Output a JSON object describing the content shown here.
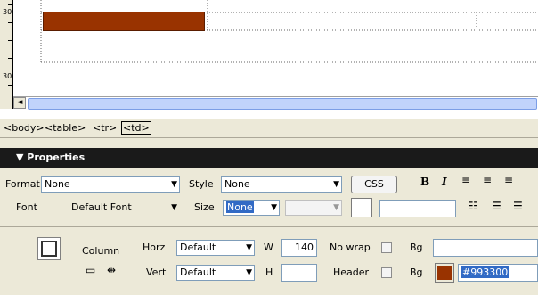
{
  "ruler": {
    "top_label": "30",
    "bottom_label": "30"
  },
  "scroll_left_arrow": "◄",
  "tag_selector": {
    "tags": [
      "<body>",
      "<table>",
      "<tr>"
    ],
    "selected": "<td>"
  },
  "properties": {
    "title": "▼ Properties",
    "format_label": "Format",
    "format_value": "None",
    "style_label": "Style",
    "style_value": "None",
    "css_button": "CSS",
    "font_label": "Font",
    "font_value": "Default Font",
    "size_label": "Size",
    "size_value": "None",
    "cell_label": "Column",
    "horz_label": "Horz",
    "horz_value": "Default",
    "vert_label": "Vert",
    "vert_value": "Default",
    "w_label": "W",
    "w_value": "140",
    "h_label": "H",
    "h_value": "",
    "nowrap_label": "No wrap",
    "header_label": "Header",
    "bg_label": "Bg",
    "bg2_label": "Bg",
    "bg_color": "#993300",
    "bg_hex_text": "#993300"
  }
}
